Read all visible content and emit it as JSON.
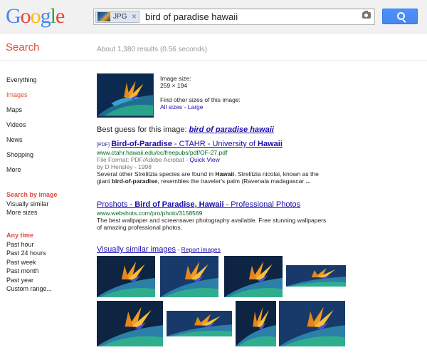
{
  "logo": {
    "letters": [
      "G",
      "o",
      "o",
      "g",
      "l",
      "e"
    ],
    "colors": [
      "#4285f4",
      "#ea4335",
      "#fbbc05",
      "#4285f4",
      "#34a853",
      "#ea4335"
    ]
  },
  "search": {
    "chip_label": "JPG",
    "chip_close": "×",
    "query": "bird of paradise hawaii"
  },
  "heading": "Search",
  "result_stats": "About 1,380 results (0.56 seconds)",
  "nav": {
    "items": [
      "Everything",
      "Images",
      "Maps",
      "Videos",
      "News",
      "Shopping",
      "More"
    ],
    "active": "Images",
    "search_by_image": {
      "header": "Search by image",
      "items": [
        "Visually similar",
        "More sizes"
      ]
    },
    "time": {
      "header": "Any time",
      "items": [
        "Past hour",
        "Past 24 hours",
        "Past week",
        "Past month",
        "Past year",
        "Custom range..."
      ]
    }
  },
  "image_info": {
    "size_label": "Image size:",
    "size_value": "259 × 194",
    "find_other": "Find other sizes of this image:",
    "all_sizes": "All sizes",
    "separator": " - ",
    "large": "Large"
  },
  "best_guess": {
    "label": "Best guess for this image: ",
    "link": "bird of paradise hawaii"
  },
  "results": [
    {
      "tag": "[PDF]",
      "title_bold": "Bird-of-Paradise",
      "title_rest": " - CTAHR - University of ",
      "title_bold2": "Hawaii",
      "url": "www.ctahr.hawaii.edu/oc/freepubs/pdf/OF-27.pdf",
      "meta1": "File Format: PDF/Adobe Acrobat - ",
      "quick_view": "Quick View",
      "meta2": "by D Hensley - 1998",
      "snippet_a": "Several other Strelitzia species are found in ",
      "snippet_b": "Hawaii",
      "snippet_c": ". Strelitzia nicolai, known as the giant ",
      "snippet_d": "bird-of-paradise",
      "snippet_e": ", resembles the traveler's palm (Ravenala madagascar ",
      "snippet_f": "..."
    },
    {
      "title_rest": "Proshots - ",
      "title_bold": "Bird of Paradise, Hawaii",
      "title_end": " - Professional Photos",
      "url": "www.webshots.com/pro/photo/3158569",
      "snippet_a": "The best wallpaper and screensaver photography available. Free stunning wallpapers of amazing professional photos."
    }
  ],
  "visually_similar": {
    "title": "Visually similar images",
    "sep": " - ",
    "report": "Report images"
  },
  "colors": {
    "link": "#1a0dab",
    "url": "#006621",
    "accent": "#dd4b39",
    "button": "#4285f4"
  }
}
